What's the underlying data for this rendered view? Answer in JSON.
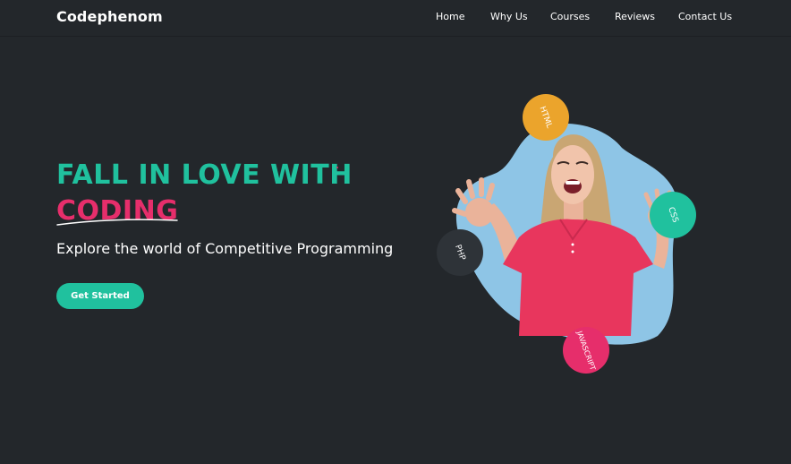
{
  "brand": {
    "name": "Codephenom"
  },
  "nav": {
    "items": [
      {
        "label": "Home"
      },
      {
        "label": "Why Us"
      },
      {
        "label": "Courses"
      },
      {
        "label": "Reviews"
      },
      {
        "label": "Contact Us"
      }
    ]
  },
  "hero": {
    "headline_1": "FALL IN LOVE WITH",
    "headline_2": "CODING",
    "subtitle": "Explore the world of Competitive Programming",
    "cta_label": "Get Started"
  },
  "badges": [
    {
      "label": "HTML",
      "color": "#eba42c"
    },
    {
      "label": "CSS",
      "color": "#20c19e"
    },
    {
      "label": "PHP",
      "color": "#2e3338"
    },
    {
      "label": "JAVASCRIPT",
      "color": "#e62e6b"
    }
  ],
  "colors": {
    "background": "#23272b",
    "accent_green": "#20c19e",
    "accent_pink": "#e62e6b",
    "blob": "#8ec5e6"
  }
}
